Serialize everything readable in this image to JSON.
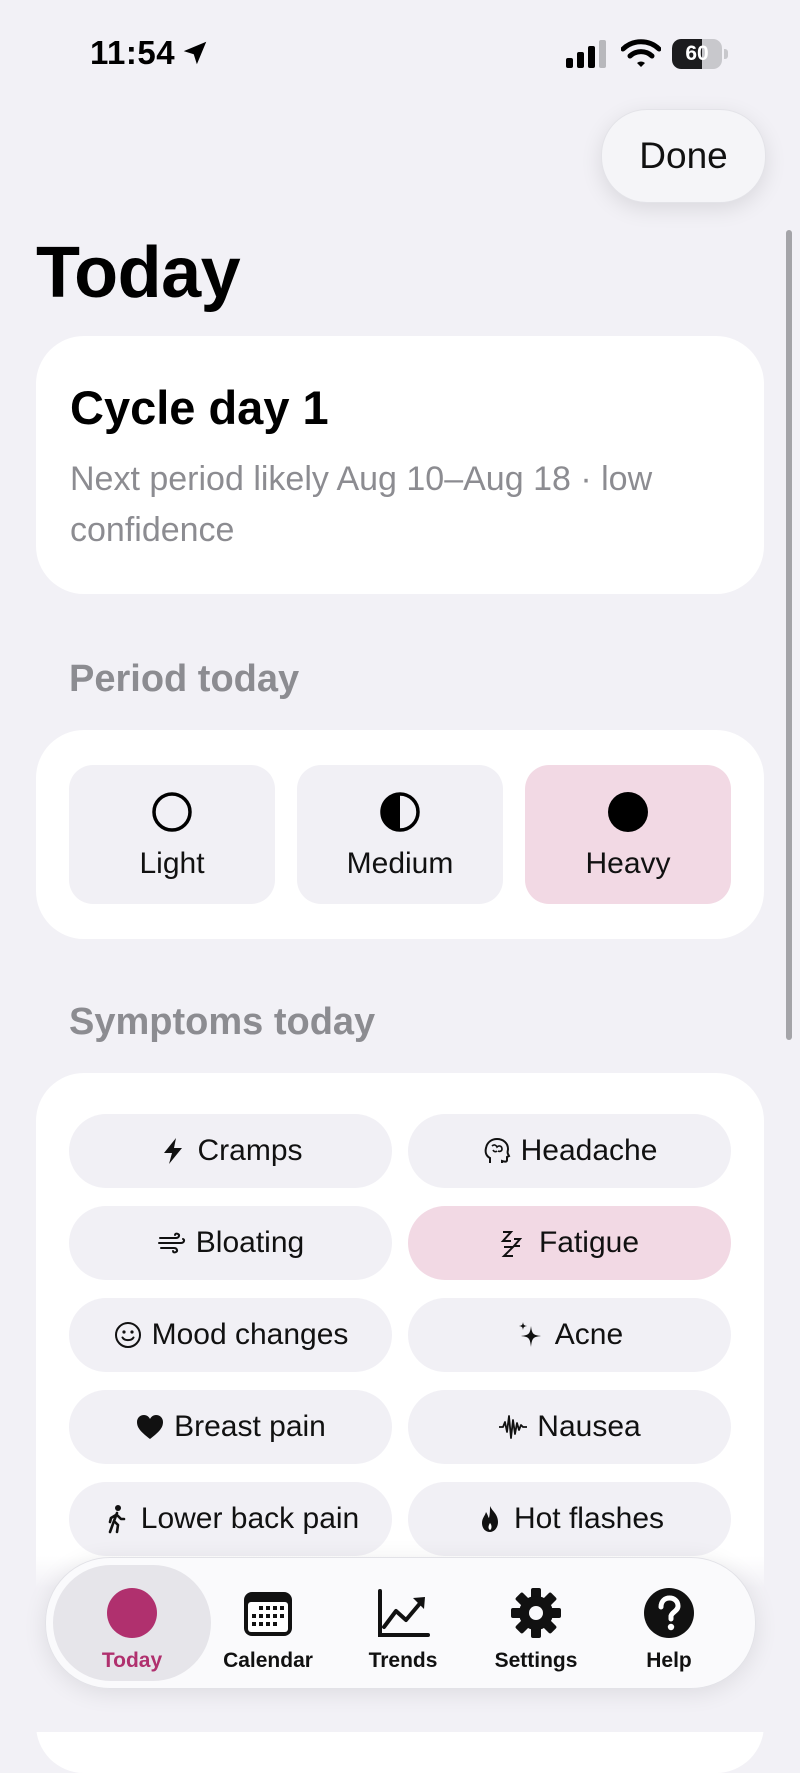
{
  "status_bar": {
    "time": "11:54",
    "battery": "60",
    "battery_level": 0.6
  },
  "nav": {
    "done_label": "Done"
  },
  "page": {
    "title": "Today"
  },
  "cycle": {
    "title": "Cycle day 1",
    "subtitle": "Next period likely Aug 10–Aug 18 · low confidence"
  },
  "period": {
    "section_label": "Period today",
    "options": [
      {
        "label": "Light",
        "icon": "circle-outline-icon",
        "selected": false
      },
      {
        "label": "Medium",
        "icon": "half-circle-icon",
        "selected": false
      },
      {
        "label": "Heavy",
        "icon": "filled-circle-icon",
        "selected": true
      }
    ]
  },
  "symptoms": {
    "section_label": "Symptoms today",
    "items": [
      {
        "label": "Cramps",
        "icon": "bolt-icon",
        "selected": false
      },
      {
        "label": "Headache",
        "icon": "brain-head-icon",
        "selected": false
      },
      {
        "label": "Bloating",
        "icon": "wind-icon",
        "selected": false
      },
      {
        "label": "Fatigue",
        "icon": "zzz-icon",
        "selected": true
      },
      {
        "label": "Mood changes",
        "icon": "smiley-icon",
        "selected": false
      },
      {
        "label": "Acne",
        "icon": "sparkles-icon",
        "selected": false
      },
      {
        "label": "Breast pain",
        "icon": "heart-icon",
        "selected": false
      },
      {
        "label": "Nausea",
        "icon": "waveform-icon",
        "selected": false
      },
      {
        "label": "Lower back pain",
        "icon": "walking-figure-icon",
        "selected": false
      },
      {
        "label": "Hot flashes",
        "icon": "flame-icon",
        "selected": false
      }
    ]
  },
  "tabs": [
    {
      "label": "Today",
      "icon": "today-dot-icon",
      "active": true
    },
    {
      "label": "Calendar",
      "icon": "calendar-icon",
      "active": false
    },
    {
      "label": "Trends",
      "icon": "chart-line-icon",
      "active": false
    },
    {
      "label": "Settings",
      "icon": "gear-icon",
      "active": false
    },
    {
      "label": "Help",
      "icon": "help-circle-icon",
      "active": false
    }
  ],
  "colors": {
    "accent": "#b0306e",
    "selected_bg": "#f2d9e4",
    "background": "#f2f1f6",
    "secondary_text": "#8c8c91"
  }
}
